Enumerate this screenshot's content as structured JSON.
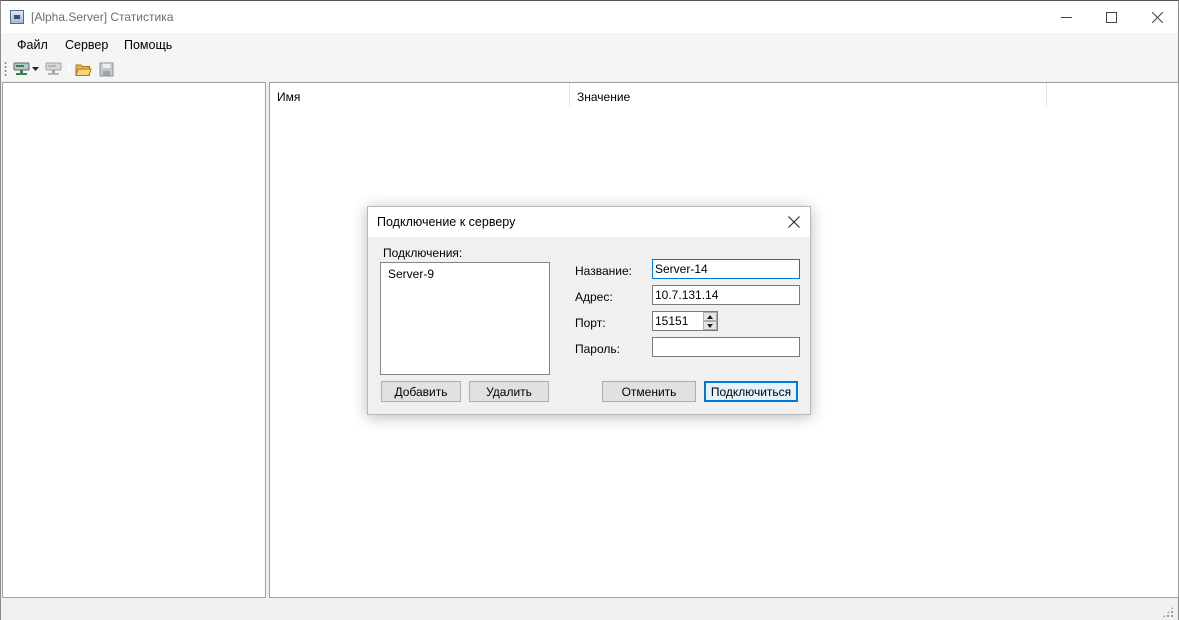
{
  "window": {
    "title": "[Alpha.Server] Статистика"
  },
  "menu": {
    "items": [
      {
        "label": "Файл"
      },
      {
        "label": "Сервер"
      },
      {
        "label": "Помощь"
      }
    ]
  },
  "toolbar": {
    "icons": [
      "connect-server-icon",
      "dropdown-arrow-icon",
      "disconnect-server-icon",
      "open-folder-icon",
      "save-icon"
    ]
  },
  "table": {
    "columns": [
      "Имя",
      "Значение"
    ]
  },
  "dialog": {
    "title": "Подключение к серверу",
    "connections_label": "Подключения:",
    "connections": [
      "Server-9"
    ],
    "name_label": "Название:",
    "name_value": "Server-14",
    "address_label": "Адрес:",
    "address_value": "10.7.131.14",
    "port_label": "Порт:",
    "port_value": "15151",
    "password_label": "Пароль:",
    "password_value": "",
    "add_button": "Добавить",
    "delete_button": "Удалить",
    "cancel_button": "Отменить",
    "connect_button": "Подключиться"
  },
  "colors": {
    "accent": "#0078d7",
    "window_bg": "#f0f0f0",
    "title_text": "#6d6d6d"
  }
}
